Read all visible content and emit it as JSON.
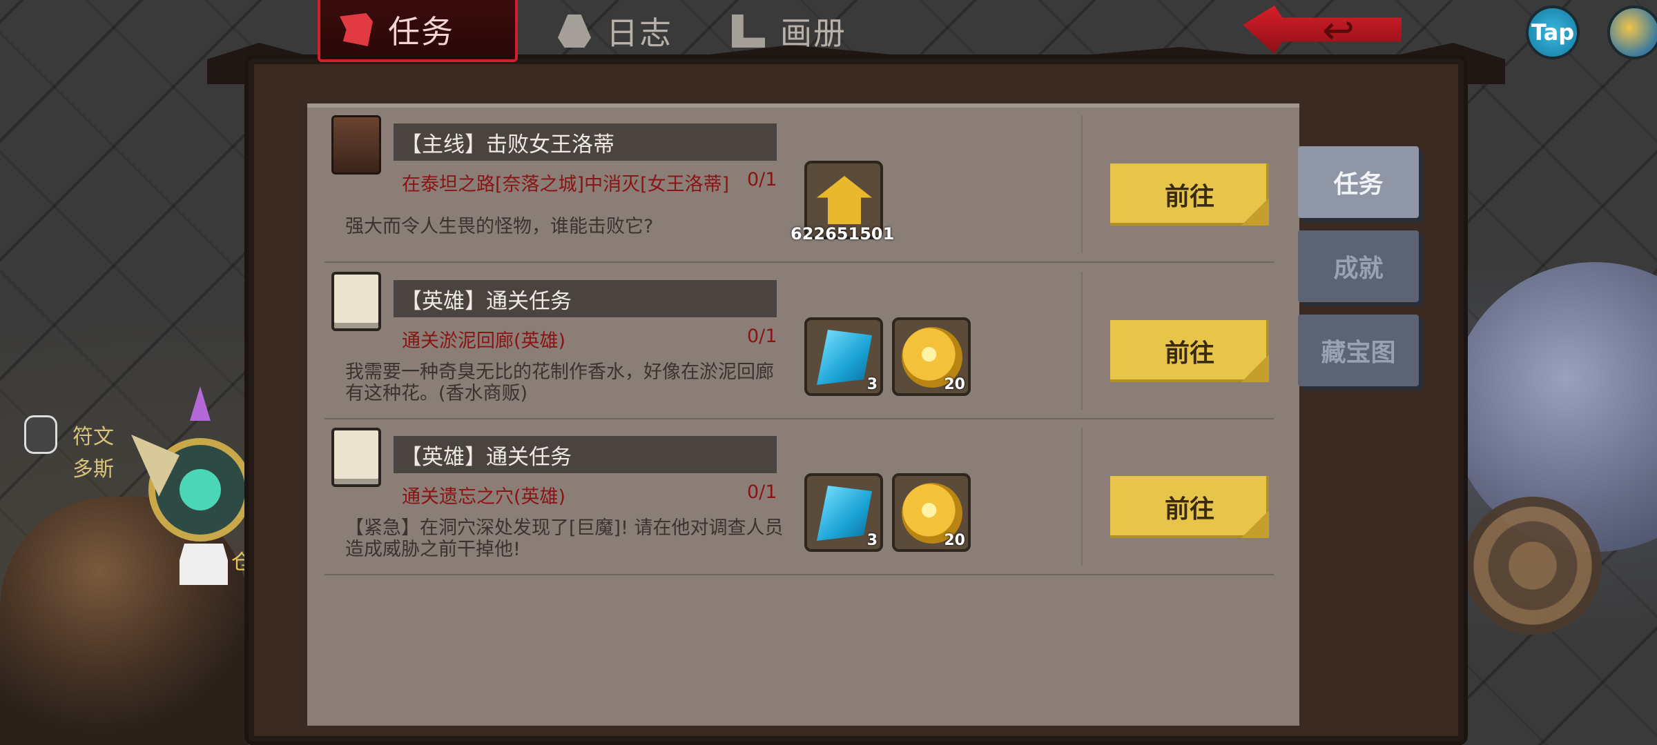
{
  "top_tabs": [
    {
      "label": "任务",
      "icon": "scroll-icon",
      "active": true
    },
    {
      "label": "日志",
      "icon": "bell-icon",
      "active": false
    },
    {
      "label": "画册",
      "icon": "album-icon",
      "active": false
    }
  ],
  "top_right": {
    "tap_label": "Tap"
  },
  "side_tabs": [
    {
      "label": "任务",
      "active": true
    },
    {
      "label": "成就",
      "active": false
    },
    {
      "label": "藏宝图",
      "active": false
    }
  ],
  "hero": {
    "label1": "符文",
    "label2": "多斯",
    "store_label": "仓"
  },
  "quests": [
    {
      "icon": "book-icon",
      "title": "【主线】击败女王洛蒂",
      "objective": "在泰坦之路[奈落之城]中消灭[女王洛蒂]",
      "progress": "0/1",
      "description": "强大而令人生畏的怪物，谁能击败它?",
      "rewards": [
        {
          "type": "rank-icon",
          "count": "622651501"
        }
      ],
      "button": "前往"
    },
    {
      "icon": "calendar-icon",
      "title": "【英雄】通关任务",
      "objective": "通关淤泥回廊(英雄)",
      "progress": "0/1",
      "description": "我需要一种奇臭无比的花制作香水，好像在淤泥回廊有这种花。(香水商贩)",
      "rewards": [
        {
          "type": "gem-icon",
          "count": "3"
        },
        {
          "type": "coin-icon",
          "count": "20"
        }
      ],
      "button": "前往"
    },
    {
      "icon": "calendar-icon",
      "title": "【英雄】通关任务",
      "objective": "通关遗忘之穴(英雄)",
      "progress": "0/1",
      "description": "【紧急】在洞穴深处发现了[巨魔]! 请在他对调查人员造成威胁之前干掉他!",
      "rewards": [
        {
          "type": "gem-icon",
          "count": "3"
        },
        {
          "type": "coin-icon",
          "count": "20"
        }
      ],
      "button": "前往"
    }
  ]
}
